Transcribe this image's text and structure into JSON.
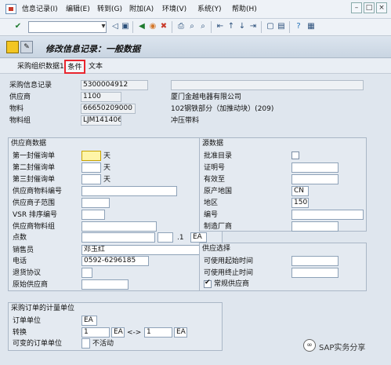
{
  "menubar": {
    "items": [
      "信息记录(I)",
      "编辑(E)",
      "转到(G)",
      "附加(A)",
      "环境(V)",
      "系统(Y)",
      "帮助(H)"
    ]
  },
  "title": "修改信息记录：一般数据",
  "app_toolbar": {
    "items": [
      "采购组织数据1",
      "条件",
      "文本"
    ],
    "highlight": "#e8262f"
  },
  "header": {
    "info_record_label": "采购信息记录",
    "info_record_value": "5300004912",
    "vendor_label": "供应商",
    "vendor_value": "1100",
    "vendor_desc": "厦门金越电器有限公司",
    "material_label": "物料",
    "material_value": "66650209000",
    "material_desc": "102钢铁部分（加推动块）(209)",
    "matgroup_label": "物料组",
    "matgroup_value": "LJM141406",
    "matgroup_desc": "冲压带料"
  },
  "vendor_data": {
    "title": "供应商数据",
    "reminder1_label": "第一封催询单",
    "reminder1_unit": "天",
    "reminder2_label": "第二封催询单",
    "reminder2_unit": "天",
    "reminder3_label": "第三封催询单",
    "reminder3_unit": "天",
    "vendor_mat_no_label": "供应商物料编号",
    "vendor_subrange_label": "供应商子范围",
    "vsr_sort_label": "VSR 排序编号",
    "vendor_mat_group_label": "供应商物料组",
    "points_label": "点数",
    "points_sep": ".1",
    "points_unit": "EA",
    "salesperson_label": "销售员",
    "salesperson_value": "邓玉红",
    "phone_label": "电话",
    "phone_value": "0592-6296185",
    "return_label": "退货协议",
    "orig_vendor_label": "原始供应商"
  },
  "source_data": {
    "title": "源数据",
    "approval_label": "批准目录",
    "cert_label": "证明号",
    "valid_label": "有效至",
    "origin_label": "原产地国",
    "origin_value": "CN",
    "region_label": "地区",
    "region_value": "150",
    "number_label": "编号",
    "manufacturer_label": "制造厂商"
  },
  "vendor_select": {
    "title": "供应选择",
    "avail_from_label": "可使用起始时间",
    "avail_to_label": "可使用终止时间",
    "regular_label": "常规供应商"
  },
  "po_unit": {
    "title": "采购订单的计量单位",
    "order_unit_label": "订单单位",
    "order_unit_value": "EA",
    "convert_label": "转换",
    "convert_left": "1",
    "convert_left_unit": "EA",
    "convert_arrow": "<->",
    "convert_right": "1",
    "convert_right_unit": "EA",
    "var_unit_label": "可变的订单单位",
    "var_unit_value": "不活动"
  },
  "watermark": {
    "text": "SAP实务分享",
    "logo": "∞"
  }
}
